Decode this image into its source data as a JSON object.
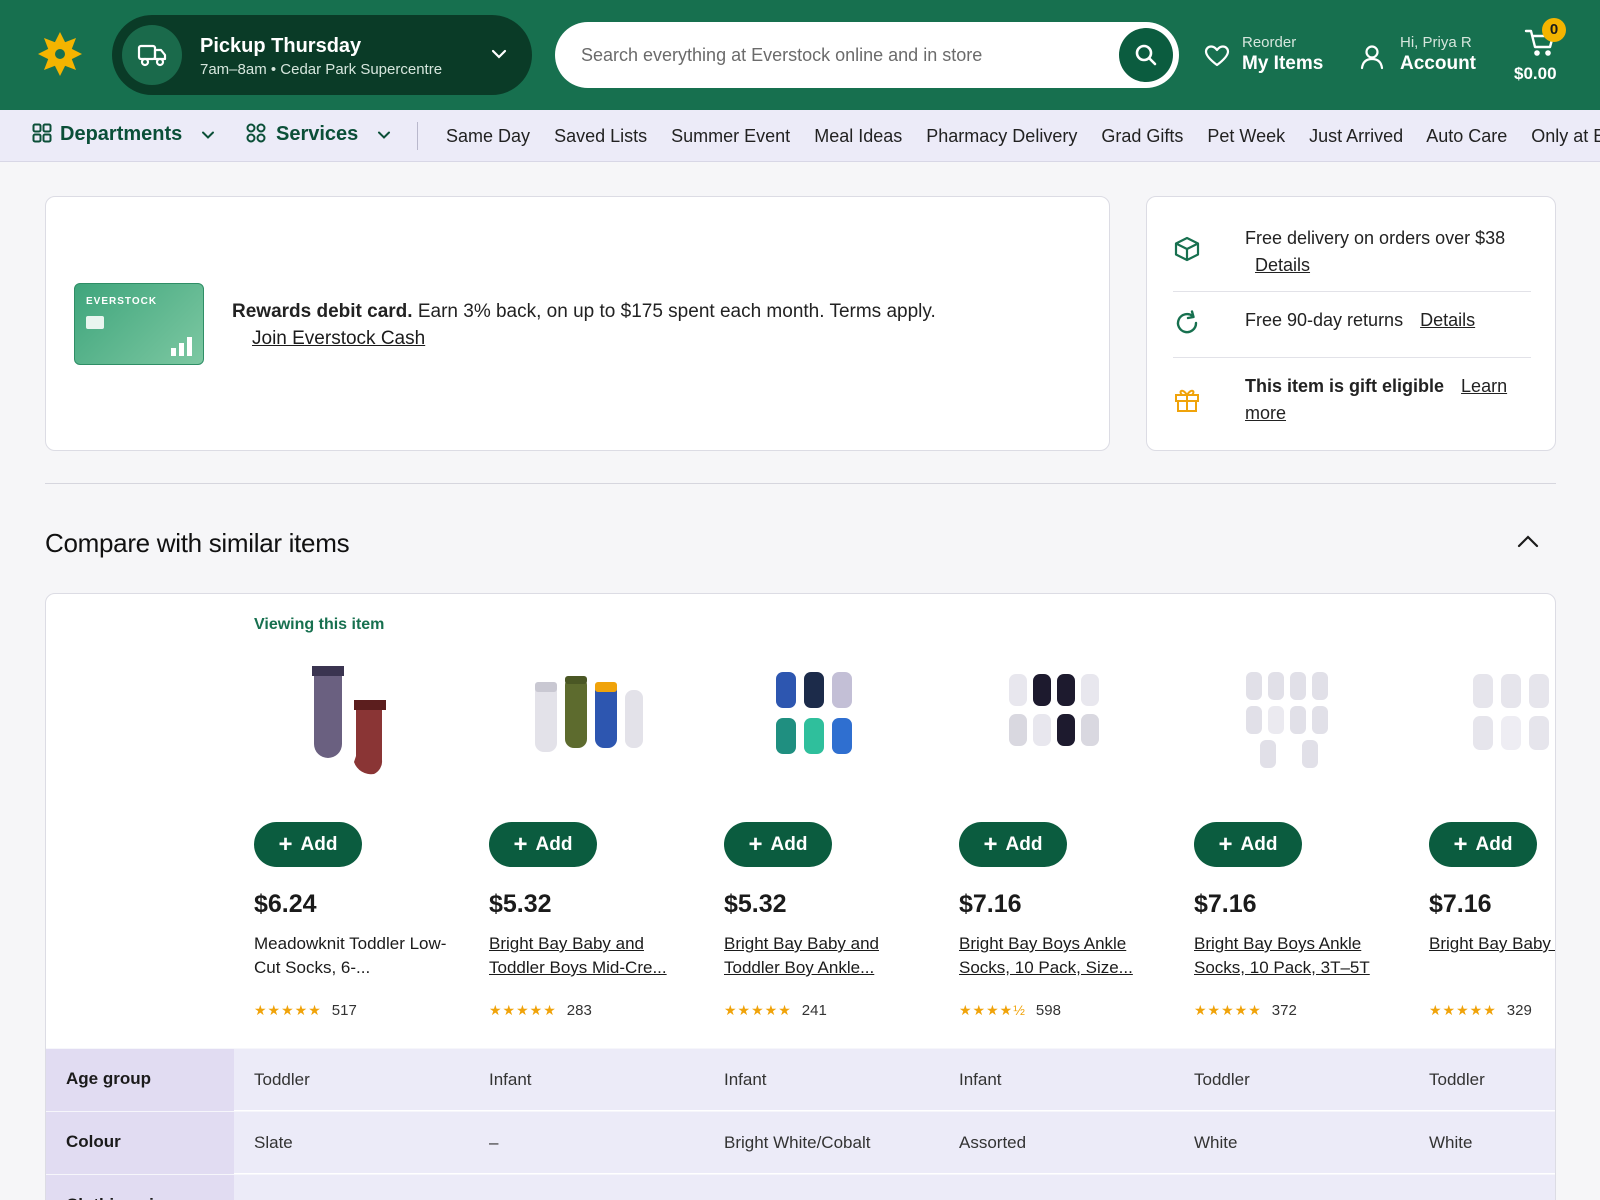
{
  "header": {
    "pickup": {
      "title": "Pickup Thursday",
      "subtitle": "7am–8am • Cedar Park Supercentre"
    },
    "search": {
      "placeholder": "Search everything at Everstock online and in store"
    },
    "reorder": {
      "small": "Reorder",
      "big": "My Items"
    },
    "account": {
      "small": "Hi, Priya R",
      "big": "Account"
    },
    "cart": {
      "count": "0",
      "total": "$0.00"
    }
  },
  "nav": {
    "departments": "Departments",
    "services": "Services",
    "links": [
      "Same Day",
      "Saved Lists",
      "Summer Event",
      "Meal Ideas",
      "Pharmacy Delivery",
      "Grad Gifts",
      "Pet Week",
      "Just Arrived",
      "Auto Care",
      "Only at Everst"
    ]
  },
  "rewards": {
    "card_brand": "EVERSTOCK",
    "bold": "Rewards debit card.",
    "text": " Earn 3% back, on up to $175 spent each month. Terms apply.",
    "link": "Join Everstock Cash"
  },
  "benefits": {
    "delivery": {
      "text": "Free delivery on orders over $38",
      "link": "Details"
    },
    "returns": {
      "text": "Free 90-day returns",
      "link": "Details"
    },
    "gift": {
      "text": "This item is gift eligible",
      "link1": "Learn",
      "link2": "more"
    }
  },
  "compare": {
    "title": "Compare with similar items",
    "viewing_label": "Viewing this item",
    "add_label": "Add",
    "products": [
      {
        "price": "$6.24",
        "name": "Meadowknit Toddler Low-Cut Socks, 6-...",
        "stars": "★★★★★",
        "reviews": "517"
      },
      {
        "price": "$5.32",
        "name": "Bright Bay Baby and Toddler Boys Mid-Cre...",
        "stars": "★★★★★",
        "reviews": "283"
      },
      {
        "price": "$5.32",
        "name": "Bright Bay Baby and Toddler Boy Ankle...",
        "stars": "★★★★★",
        "reviews": "241"
      },
      {
        "price": "$7.16",
        "name": "Bright Bay Boys Ankle Socks, 10 Pack, Size...",
        "stars": "★★★★½",
        "reviews": "598"
      },
      {
        "price": "$7.16",
        "name": "Bright Bay Boys Ankle Socks, 10 Pack, 3T–5T",
        "stars": "★★★★★",
        "reviews": "372"
      },
      {
        "price": "$7.16",
        "name": "Bright Bay Baby Toddler Crew So",
        "stars": "★★★★★",
        "reviews": "329"
      }
    ],
    "specs": [
      {
        "label": "Age group",
        "values": [
          "Toddler",
          "Infant",
          "Infant",
          "Infant",
          "Toddler",
          "Toddler"
        ]
      },
      {
        "label": "Colour",
        "values": [
          "Slate",
          "–",
          "Bright White/Cobalt",
          "Assorted",
          "White",
          "White"
        ]
      },
      {
        "label": "Clothing size",
        "values": [
          "",
          "",
          "",
          "",
          "",
          ""
        ]
      }
    ]
  },
  "colors": {
    "brand_green": "#17704f",
    "dark_green": "#0b5c3f",
    "star": "#f0a30a",
    "accent_yellow": "#f4b400"
  }
}
